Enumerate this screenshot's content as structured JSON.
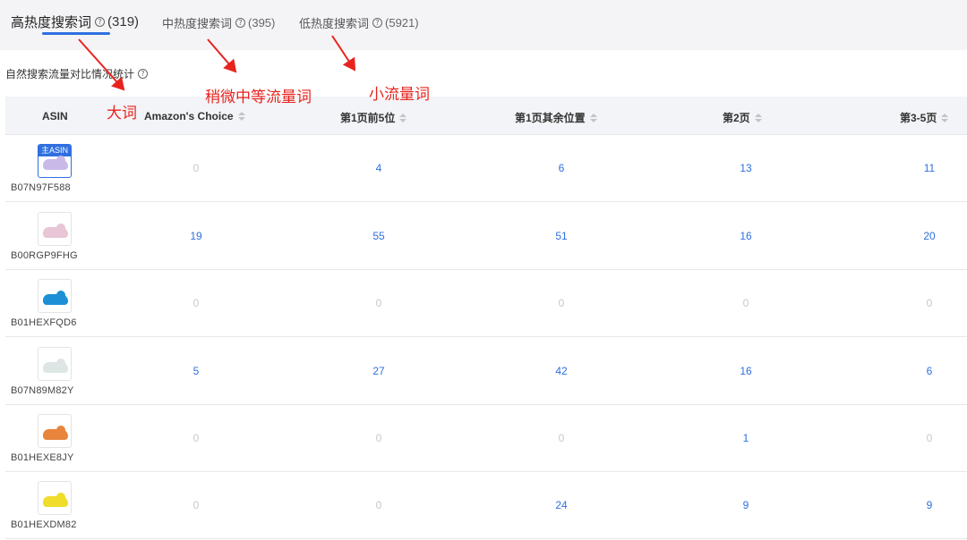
{
  "tabs": [
    {
      "label": "高热度搜索词",
      "count": "(319)",
      "active": true
    },
    {
      "label": "中热度搜索词",
      "count": "(395)",
      "active": false
    },
    {
      "label": "低热度搜索词",
      "count": "(5921)",
      "active": false
    }
  ],
  "section_title": "自然搜索流量对比情况统计",
  "help_glyph": "?",
  "columns": [
    "ASIN",
    "Amazon's Choice",
    "第1页前5位",
    "第1页其余位置",
    "第2页",
    "第3-5页"
  ],
  "main_badge": "主ASIN",
  "rows": [
    {
      "asin": "B07N97F588",
      "main": true,
      "shoe_color": "#c9b9e8",
      "values": [
        "0",
        "4",
        "6",
        "13",
        "11"
      ]
    },
    {
      "asin": "B00RGP9FHG",
      "main": false,
      "shoe_color": "#e8c6d6",
      "values": [
        "19",
        "55",
        "51",
        "16",
        "20"
      ]
    },
    {
      "asin": "B01HEXFQD6",
      "main": false,
      "shoe_color": "#1d8fd6",
      "values": [
        "0",
        "0",
        "0",
        "0",
        "0"
      ]
    },
    {
      "asin": "B07N89M82Y",
      "main": false,
      "shoe_color": "#dde6e4",
      "values": [
        "5",
        "27",
        "42",
        "16",
        "6"
      ]
    },
    {
      "asin": "B01HEXE8JY",
      "main": false,
      "shoe_color": "#e9843c",
      "values": [
        "0",
        "0",
        "0",
        "1",
        "0"
      ]
    },
    {
      "asin": "B01HEXDM82",
      "main": false,
      "shoe_color": "#f0dc2a",
      "values": [
        "0",
        "0",
        "24",
        "9",
        "9"
      ]
    }
  ],
  "annotations": {
    "big": "大词",
    "medium": "稍微中等流量词",
    "small": "小流量词"
  },
  "colors": {
    "accent": "#2f6fe0",
    "annotation": "#e8231e",
    "zero": "#c8c8c8"
  }
}
